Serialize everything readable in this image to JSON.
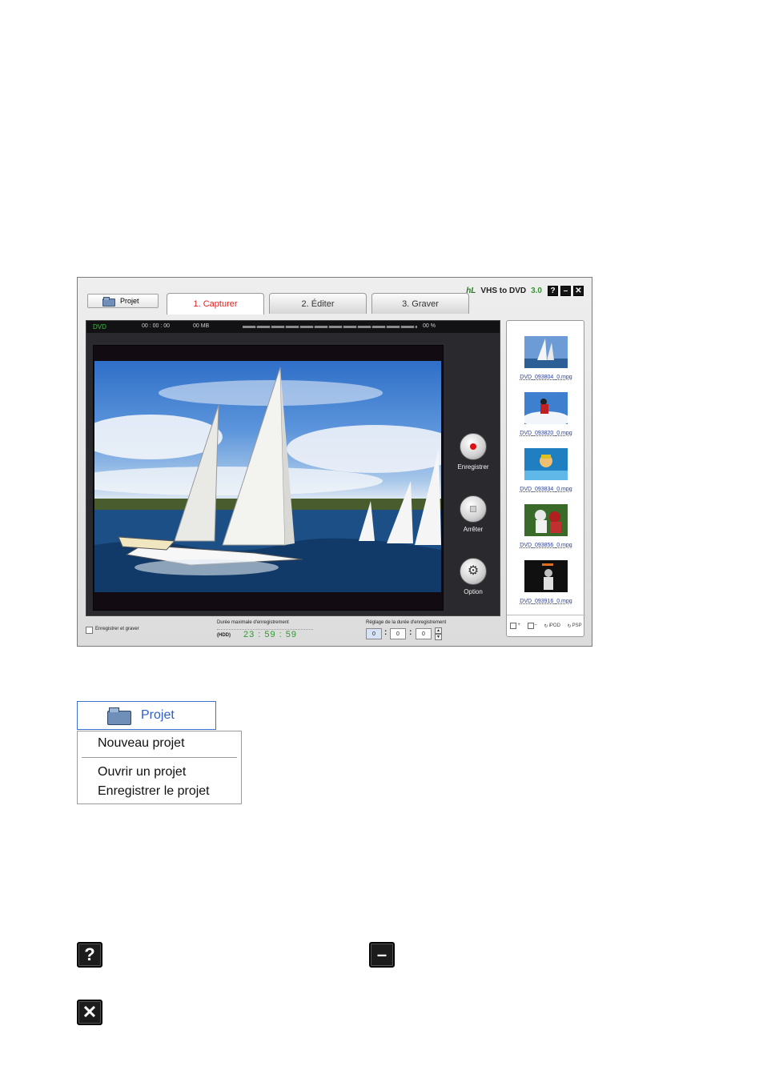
{
  "app": {
    "brand_logo": "hL",
    "brand_title": "VHS to DVD",
    "brand_version": "3.0",
    "window_buttons": {
      "help": "?",
      "minimize": "–",
      "close": "✕"
    },
    "projet_button": "Projet",
    "tabs": [
      "1. Capturer",
      "2.  Éditer",
      "3. Graver"
    ],
    "active_tab": "1. Capturer",
    "status": {
      "format": "DVD",
      "time": "00 : 00 : 00",
      "size": "00 MB",
      "percent": "00 %",
      "progress": 0
    },
    "controls": {
      "record": "Enregistrer",
      "stop": "Arrêter",
      "option": "Option"
    },
    "bottom": {
      "checkbox_label": "Enregistrer et graver",
      "max_duration_label": "Durée maximale d'enregistrement",
      "hdd_label": "(HDD)",
      "max_duration": "23 : 59 : 59",
      "setting_label": "Réglage de la durée d'enregistrement",
      "spin_values": [
        "0",
        "0",
        "0"
      ]
    },
    "thumbnails": [
      {
        "caption": "DVD_093804_0.mpg",
        "icon": "sailboat-thumbnail"
      },
      {
        "caption": "DVD_093820_0.mpg",
        "icon": "skier-thumbnail"
      },
      {
        "caption": "DVD_093834_0.mpg",
        "icon": "swimmer-thumbnail"
      },
      {
        "caption": "DVD_093856_0.mpg",
        "icon": "football-thumbnail"
      },
      {
        "caption": "DVD_093916_0.mpg",
        "icon": "basketball-thumbnail"
      }
    ],
    "thumb_tools": [
      "add-file-icon",
      "remove-file-icon",
      "convert-ipod-icon",
      "convert-psp-icon"
    ],
    "thumb_tool_labels": {
      "ipod": "iPOD",
      "psp": "PSP"
    }
  },
  "projet_zoom": {
    "label": "Projet",
    "menu": [
      "Nouveau projet",
      "Ouvrir un projet",
      "Enregistrer le projet"
    ]
  },
  "big_icons": {
    "help": "?",
    "minimize": "–",
    "close": "✕"
  },
  "colors": {
    "active_tab": "#e02020",
    "accent_green": "#2e9a2e",
    "link_blue": "#2a3e94",
    "menu_border": "#3b6fd0"
  }
}
